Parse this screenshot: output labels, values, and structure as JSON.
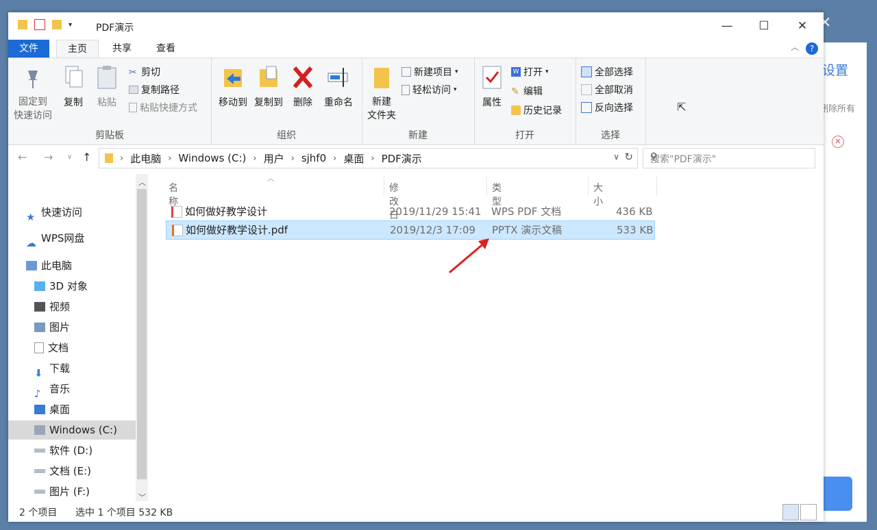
{
  "background": {
    "link": "设置",
    "delete_all": "删除所有",
    "close_glyph": "✕",
    "top_close": "×"
  },
  "window": {
    "title": "PDF演示",
    "minimize": "—",
    "maximize": "☐",
    "close": "✕"
  },
  "tabs": [
    {
      "label": "文件"
    },
    {
      "label": "主页"
    },
    {
      "label": "共享"
    },
    {
      "label": "查看"
    }
  ],
  "ribbon": {
    "clipboard": {
      "label": "剪贴板",
      "pin": "固定到\n快速访问",
      "copy": "复制",
      "paste": "粘贴",
      "cut": "剪切",
      "copy_path": "复制路径",
      "paste_shortcut": "粘贴快捷方式"
    },
    "organize": {
      "label": "组织",
      "move_to": "移动到",
      "copy_to": "复制到",
      "delete": "删除",
      "rename": "重命名"
    },
    "new": {
      "label": "新建",
      "new_folder": "新建\n文件夹",
      "new_item": "新建项目",
      "easy_access": "轻松访问"
    },
    "open": {
      "label": "打开",
      "properties": "属性",
      "open": "打开",
      "edit": "编辑",
      "history": "历史记录"
    },
    "select": {
      "label": "选择",
      "select_all": "全部选择",
      "select_none": "全部取消",
      "invert": "反向选择"
    }
  },
  "address": {
    "crumbs": [
      "此电脑",
      "Windows (C:)",
      "用户",
      "sjhf0",
      "桌面",
      "PDF演示"
    ],
    "search_placeholder": "搜索\"PDF演示\""
  },
  "nav": [
    {
      "label": "快速访问",
      "icon": "star-icon"
    },
    {
      "label": "WPS网盘",
      "icon": "cloud-icon"
    },
    {
      "label": "此电脑",
      "icon": "computer-icon"
    },
    {
      "label": "3D 对象",
      "icon": "cube-icon"
    },
    {
      "label": "视频",
      "icon": "video-icon"
    },
    {
      "label": "图片",
      "icon": "picture-icon"
    },
    {
      "label": "文档",
      "icon": "document-icon"
    },
    {
      "label": "下载",
      "icon": "download-icon"
    },
    {
      "label": "音乐",
      "icon": "music-icon"
    },
    {
      "label": "桌面",
      "icon": "desktop-icon"
    },
    {
      "label": "Windows (C:)",
      "icon": "drive-icon"
    },
    {
      "label": "软件 (D:)",
      "icon": "drive-icon"
    },
    {
      "label": "文档 (E:)",
      "icon": "drive-icon"
    },
    {
      "label": "图片 (F:)",
      "icon": "drive-icon"
    }
  ],
  "columns": {
    "name": "名称",
    "date": "修改日期",
    "type": "类型",
    "size": "大小"
  },
  "files": [
    {
      "name": "如何做好教学设计",
      "date": "2019/11/29 15:41",
      "type": "WPS PDF 文档",
      "size": "436 KB"
    },
    {
      "name": "如何做好教学设计.pdf",
      "date": "2019/12/3 17:09",
      "type": "PPTX 演示文稿",
      "size": "533 KB"
    }
  ],
  "status": {
    "count": "2 个项目",
    "selected": "选中 1 个项目  532 KB"
  },
  "colors": {
    "accent": "#1c6ad6",
    "selection": "#cce8ff",
    "arrow": "#e02020"
  }
}
